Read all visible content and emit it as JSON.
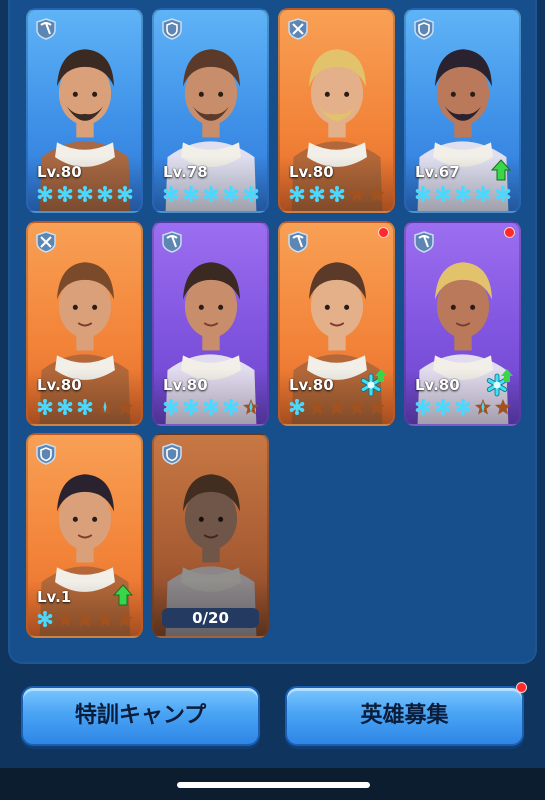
{
  "colors": {
    "star_active": "#4ad8ff",
    "star_empty": "#a2521f",
    "upgrade_arrow": "#39d64a",
    "notification": "#ff2b2b"
  },
  "heroes": [
    {
      "name_icon": "pickaxe-icon",
      "rarity": "blue",
      "level": "Lv.80",
      "stars": [
        1,
        1,
        1,
        1,
        1
      ],
      "upgrade": false,
      "awaken": false,
      "notice": false
    },
    {
      "name_icon": "shield-icon",
      "rarity": "blue",
      "level": "Lv.78",
      "stars": [
        1,
        1,
        1,
        1,
        1
      ],
      "upgrade": false,
      "awaken": false,
      "notice": false
    },
    {
      "name_icon": "crossed-tools-icon",
      "rarity": "orange",
      "level": "Lv.80",
      "stars": [
        1,
        1,
        1,
        0,
        0
      ],
      "upgrade": false,
      "awaken": false,
      "notice": false
    },
    {
      "name_icon": "shield-icon",
      "rarity": "blue",
      "level": "Lv.67",
      "stars": [
        1,
        1,
        1,
        1,
        1
      ],
      "upgrade": true,
      "awaken": false,
      "notice": false
    },
    {
      "name_icon": "crossed-tools-icon",
      "rarity": "orange",
      "level": "Lv.80",
      "stars": [
        1,
        1,
        1,
        0.5,
        0
      ],
      "upgrade": false,
      "awaken": false,
      "notice": false
    },
    {
      "name_icon": "pickaxe-icon",
      "rarity": "purple",
      "level": "Lv.80",
      "stars": [
        1,
        1,
        1,
        1,
        0.5
      ],
      "upgrade": false,
      "awaken": false,
      "notice": false
    },
    {
      "name_icon": "pickaxe-icon",
      "rarity": "orange",
      "level": "Lv.80",
      "stars": [
        1,
        0,
        0,
        0,
        0
      ],
      "upgrade": false,
      "awaken": true,
      "notice": true
    },
    {
      "name_icon": "pickaxe-icon",
      "rarity": "purple",
      "level": "Lv.80",
      "stars": [
        1,
        1,
        1,
        0.5,
        0
      ],
      "upgrade": false,
      "awaken": true,
      "notice": true
    },
    {
      "name_icon": "shield-icon",
      "rarity": "orange",
      "level": "Lv.1",
      "stars": [
        1,
        0,
        0,
        0,
        0
      ],
      "upgrade": true,
      "awaken": false,
      "notice": false
    },
    {
      "name_icon": "shield-icon",
      "rarity": "locked",
      "fragments": "0/20",
      "notice": false
    }
  ],
  "buttons": {
    "training": "特訓キャンプ",
    "recruit": "英雄募集",
    "recruit_notice": true
  }
}
